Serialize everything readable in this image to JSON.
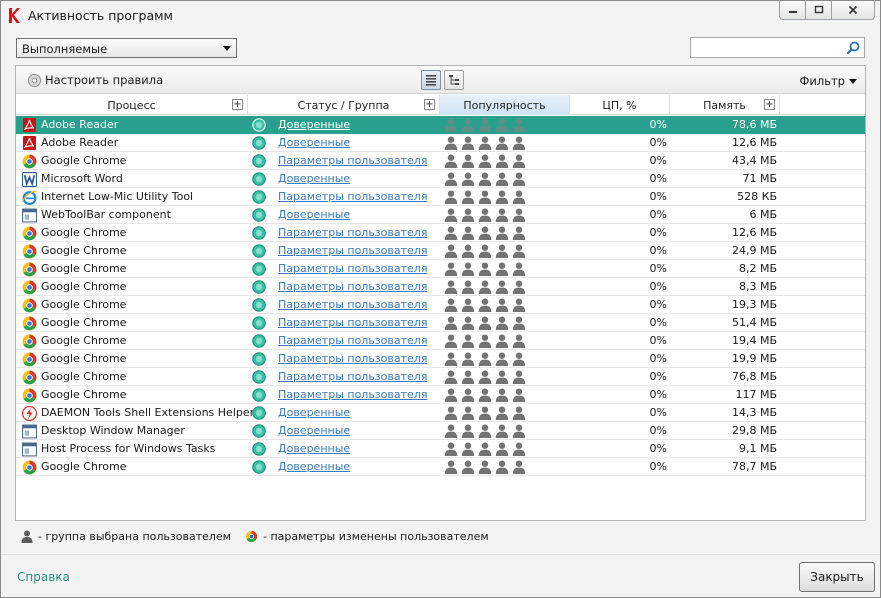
{
  "window": {
    "title": "Активность программ",
    "controls": {
      "minimize": "‒",
      "maximize": "☐",
      "close": "✕"
    }
  },
  "filter_dropdown": {
    "value": "Выполняемые"
  },
  "search": {
    "value": "",
    "placeholder": ""
  },
  "toolbar": {
    "rules_label": "Настроить правила",
    "filter_label": "Фильтр"
  },
  "columns": {
    "process": "Процесс",
    "status": "Статус / Группа",
    "popularity": "Популярность",
    "cpu": "ЦП, %",
    "memory": "Память"
  },
  "colors": {
    "selected_row": "#29a08d",
    "link": "#3a7ac0",
    "help_link": "#2f8f80"
  },
  "rows": [
    {
      "icon": "adobe-reader-icon",
      "name": "Adobe Reader",
      "group": "Доверенные",
      "cpu": "0%",
      "memory": "78,6 МБ",
      "selected": true
    },
    {
      "icon": "adobe-reader-icon",
      "name": "Adobe Reader",
      "group": "Доверенные",
      "cpu": "0%",
      "memory": "12,6 МБ"
    },
    {
      "icon": "chrome-icon",
      "name": "Google Chrome",
      "group": "Параметры пользователя",
      "cpu": "0%",
      "memory": "43,4 МБ"
    },
    {
      "icon": "word-icon",
      "name": "Microsoft Word",
      "group": "Доверенные",
      "cpu": "0%",
      "memory": "71 МБ"
    },
    {
      "icon": "ie-icon",
      "name": "Internet Low-Mic Utility Tool",
      "group": "Параметры пользователя",
      "cpu": "0%",
      "memory": "528 КБ"
    },
    {
      "icon": "window-app-icon",
      "name": "WebToolBar component",
      "group": "Доверенные",
      "cpu": "0%",
      "memory": "6 МБ"
    },
    {
      "icon": "chrome-icon",
      "name": "Google Chrome",
      "group": "Параметры пользователя",
      "cpu": "0%",
      "memory": "12,6 МБ"
    },
    {
      "icon": "chrome-icon",
      "name": "Google Chrome",
      "group": "Параметры пользователя",
      "cpu": "0%",
      "memory": "24,9 МБ"
    },
    {
      "icon": "chrome-icon",
      "name": "Google Chrome",
      "group": "Параметры пользователя",
      "cpu": "0%",
      "memory": "8,2 МБ"
    },
    {
      "icon": "chrome-icon",
      "name": "Google Chrome",
      "group": "Параметры пользователя",
      "cpu": "0%",
      "memory": "8,3 МБ"
    },
    {
      "icon": "chrome-icon",
      "name": "Google Chrome",
      "group": "Параметры пользователя",
      "cpu": "0%",
      "memory": "19,3 МБ"
    },
    {
      "icon": "chrome-icon",
      "name": "Google Chrome",
      "group": "Параметры пользователя",
      "cpu": "0%",
      "memory": "51,4 МБ"
    },
    {
      "icon": "chrome-icon",
      "name": "Google Chrome",
      "group": "Параметры пользователя",
      "cpu": "0%",
      "memory": "19,4 МБ"
    },
    {
      "icon": "chrome-icon",
      "name": "Google Chrome",
      "group": "Параметры пользователя",
      "cpu": "0%",
      "memory": "19,9 МБ"
    },
    {
      "icon": "chrome-icon",
      "name": "Google Chrome",
      "group": "Параметры пользователя",
      "cpu": "0%",
      "memory": "76,8 МБ"
    },
    {
      "icon": "chrome-icon",
      "name": "Google Chrome",
      "group": "Параметры пользователя",
      "cpu": "0%",
      "memory": "117 МБ"
    },
    {
      "icon": "daemon-tools-icon",
      "name": "DAEMON Tools Shell Extensions Helper",
      "group": "Доверенные",
      "cpu": "0%",
      "memory": "14,3 МБ"
    },
    {
      "icon": "window-app-icon",
      "name": "Desktop Window Manager",
      "group": "Доверенные",
      "cpu": "0%",
      "memory": "29,8 МБ"
    },
    {
      "icon": "window-app-icon",
      "name": "Host Process for Windows Tasks",
      "group": "Доверенные",
      "cpu": "0%",
      "memory": "9,1 МБ"
    },
    {
      "icon": "chrome-icon",
      "name": "Google Chrome",
      "group": "Доверенные",
      "cpu": "0%",
      "memory": "78,7 МБ"
    }
  ],
  "legend": {
    "user_group": "- группа выбрана пользователем",
    "user_params": "- параметры изменены пользователем"
  },
  "footer": {
    "help_label": "Справка",
    "close_label": "Закрыть"
  }
}
